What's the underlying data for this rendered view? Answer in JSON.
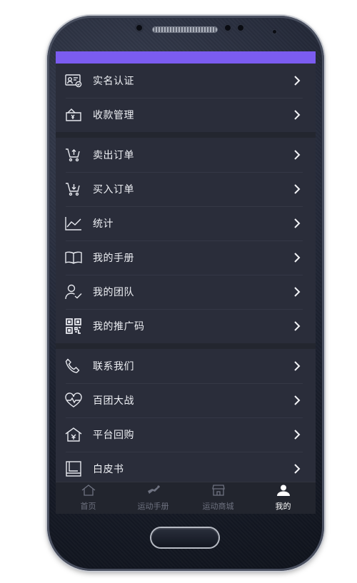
{
  "menu": {
    "group1": [
      {
        "label": "实名认证",
        "icon": "id-card-icon"
      },
      {
        "label": "收款管理",
        "icon": "wallet-yen-icon"
      }
    ],
    "group2": [
      {
        "label": "卖出订单",
        "icon": "cart-sell-icon"
      },
      {
        "label": "买入订单",
        "icon": "cart-buy-icon"
      },
      {
        "label": "统计",
        "icon": "line-chart-icon"
      },
      {
        "label": "我的手册",
        "icon": "book-icon"
      },
      {
        "label": "我的团队",
        "icon": "team-icon"
      },
      {
        "label": "我的推广码",
        "icon": "qr-code-icon"
      }
    ],
    "group3": [
      {
        "label": "联系我们",
        "icon": "phone-icon"
      },
      {
        "label": "百团大战",
        "icon": "heart-pulse-icon"
      },
      {
        "label": "平台回购",
        "icon": "house-yen-icon"
      },
      {
        "label": "白皮书",
        "icon": "whitepaper-icon"
      }
    ]
  },
  "tabbar": [
    {
      "label": "首页",
      "icon": "home-icon",
      "active": false
    },
    {
      "label": "运动手册",
      "icon": "runner-icon",
      "active": false
    },
    {
      "label": "运动商城",
      "icon": "store-icon",
      "active": false
    },
    {
      "label": "我的",
      "icon": "user-icon",
      "active": true
    }
  ],
  "colors": {
    "status_bar": "#7b5cf0",
    "background": "#2a2d3a",
    "text": "#eef0f4",
    "tab_inactive": "#6e7280",
    "tab_active": "#ffffff"
  }
}
